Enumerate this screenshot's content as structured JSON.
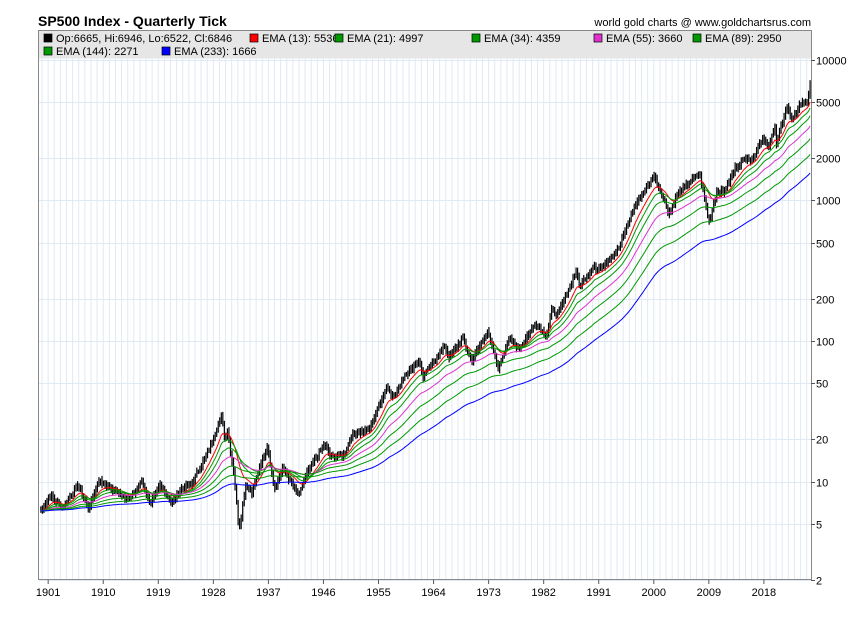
{
  "chart_data": {
    "type": "line",
    "title": "SP500 Index - Quarterly Tick",
    "credit": "world gold charts @ www.goldchartsrus.com",
    "scale": "log",
    "ylim": [
      2,
      16000
    ],
    "xlim": [
      1899.7,
      2025.9
    ],
    "grid": true,
    "legend_placement": "top",
    "x_ticks": [
      "1901",
      "1910",
      "1919",
      "1928",
      "1937",
      "1946",
      "1955",
      "1964",
      "1973",
      "1982",
      "1991",
      "2000",
      "2009",
      "2018"
    ],
    "y_ticks": [
      10000,
      5000,
      2000,
      1000,
      500,
      200,
      100,
      50,
      20,
      10,
      5,
      2
    ],
    "y_tick_labels": [
      "10000",
      "5000",
      "2000",
      "1000",
      "500",
      "200",
      "100",
      "50",
      "20",
      "10",
      "5",
      "2"
    ],
    "last_bar": {
      "open": 6665,
      "high": 6946,
      "low": 6522,
      "close": 6846
    },
    "legend": [
      {
        "label": "Op:6665, Hi:6946, Lo:6522, Cl:6846",
        "color": "#000000"
      },
      {
        "label": "EMA (13): 5536",
        "color": "#ff0000",
        "period": 13
      },
      {
        "label": "EMA (21): 4997",
        "color": "#009900",
        "period": 21
      },
      {
        "label": "EMA (34): 4359",
        "color": "#009900",
        "period": 34
      },
      {
        "label": "EMA (55): 3660",
        "color": "#dd33cc",
        "period": 55
      },
      {
        "label": "EMA (89): 2950",
        "color": "#009900",
        "period": 89
      },
      {
        "label": "EMA (144): 2271",
        "color": "#009900",
        "period": 144
      },
      {
        "label": "EMA (233): 1666",
        "color": "#0000ff",
        "period": 233
      }
    ],
    "close_keyframes": [
      [
        1900.0,
        6.2
      ],
      [
        1901.5,
        8.0
      ],
      [
        1903.5,
        6.5
      ],
      [
        1906.0,
        9.5
      ],
      [
        1907.8,
        6.5
      ],
      [
        1909.5,
        10.2
      ],
      [
        1911.0,
        9.2
      ],
      [
        1914.5,
        7.5
      ],
      [
        1916.5,
        10.0
      ],
      [
        1917.9,
        7.0
      ],
      [
        1919.5,
        9.5
      ],
      [
        1921.5,
        7.0
      ],
      [
        1923.0,
        9.0
      ],
      [
        1924.5,
        9.5
      ],
      [
        1926.0,
        12.5
      ],
      [
        1927.5,
        17.0
      ],
      [
        1929.6,
        30.0
      ],
      [
        1930.0,
        21.0
      ],
      [
        1930.5,
        23.0
      ],
      [
        1931.5,
        12.0
      ],
      [
        1932.4,
        4.6
      ],
      [
        1933.5,
        9.5
      ],
      [
        1934.5,
        8.5
      ],
      [
        1937.0,
        18.0
      ],
      [
        1938.2,
        9.0
      ],
      [
        1939.5,
        12.5
      ],
      [
        1942.2,
        8.0
      ],
      [
        1943.5,
        11.5
      ],
      [
        1946.3,
        18.5
      ],
      [
        1947.5,
        15.0
      ],
      [
        1949.5,
        15.5
      ],
      [
        1951.0,
        22.0
      ],
      [
        1953.7,
        23.5
      ],
      [
        1956.5,
        47.0
      ],
      [
        1957.8,
        40.0
      ],
      [
        1959.5,
        58.0
      ],
      [
        1961.8,
        72.0
      ],
      [
        1962.5,
        56.0
      ],
      [
        1966.0,
        92.0
      ],
      [
        1966.8,
        76.0
      ],
      [
        1968.9,
        106.0
      ],
      [
        1970.4,
        72.0
      ],
      [
        1973.0,
        118.0
      ],
      [
        1974.8,
        64.0
      ],
      [
        1976.5,
        105.0
      ],
      [
        1978.2,
        88.0
      ],
      [
        1980.9,
        135.0
      ],
      [
        1982.6,
        108.0
      ],
      [
        1983.5,
        165.0
      ],
      [
        1984.5,
        155.0
      ],
      [
        1987.6,
        320.0
      ],
      [
        1987.9,
        240.0
      ],
      [
        1990.5,
        350.0
      ],
      [
        1990.8,
        310.0
      ],
      [
        1994.5,
        460.0
      ],
      [
        1997.0,
        900.0
      ],
      [
        2000.2,
        1500.0
      ],
      [
        2001.7,
        1050.0
      ],
      [
        2002.8,
        800.0
      ],
      [
        2004.0,
        1120.0
      ],
      [
        2007.7,
        1550.0
      ],
      [
        2009.2,
        700.0
      ],
      [
        2010.5,
        1150.0
      ],
      [
        2011.7,
        1150.0
      ],
      [
        2013.5,
        1700.0
      ],
      [
        2015.5,
        2050.0
      ],
      [
        2016.1,
        1900.0
      ],
      [
        2018.0,
        2800.0
      ],
      [
        2018.9,
        2450.0
      ],
      [
        2020.0,
        3250.0
      ],
      [
        2020.2,
        2450.0
      ],
      [
        2021.9,
        4750.0
      ],
      [
        2022.8,
        3600.0
      ],
      [
        2024.0,
        4800.0
      ],
      [
        2025.2,
        5000.0
      ],
      [
        2025.9,
        6846.0
      ]
    ]
  }
}
